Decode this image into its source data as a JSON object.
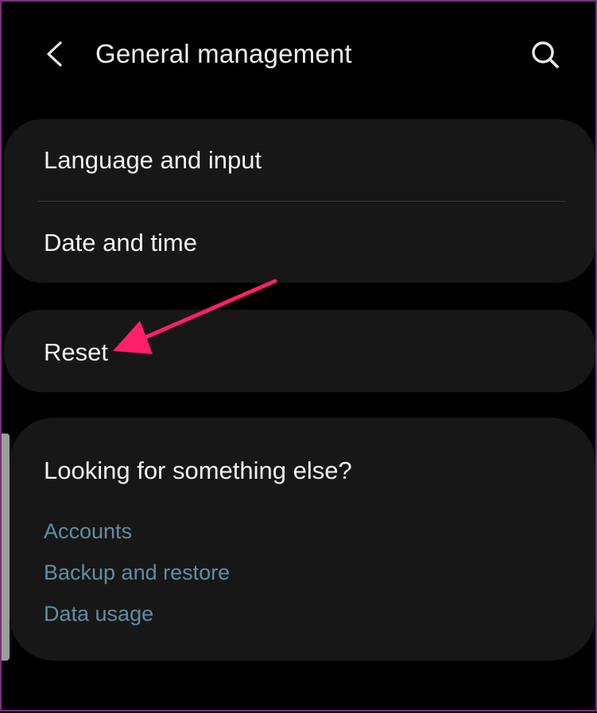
{
  "header": {
    "title": "General management",
    "back_icon": "chevron-left-icon",
    "search_icon": "search-icon"
  },
  "settings_group_1": {
    "items": [
      {
        "label": "Language and input"
      },
      {
        "label": "Date and time"
      }
    ]
  },
  "settings_group_2": {
    "items": [
      {
        "label": "Reset"
      }
    ]
  },
  "suggestions": {
    "title": "Looking for something else?",
    "links": [
      {
        "label": "Accounts"
      },
      {
        "label": "Backup and restore"
      },
      {
        "label": "Data usage"
      }
    ]
  },
  "annotation": {
    "arrow_color": "#ff1f6b",
    "arrow_target": "Reset"
  },
  "colors": {
    "background": "#000000",
    "card": "#171717",
    "text": "#f2f2f2",
    "link": "#5e8ea3",
    "frame_border": "#7a2f7a"
  }
}
